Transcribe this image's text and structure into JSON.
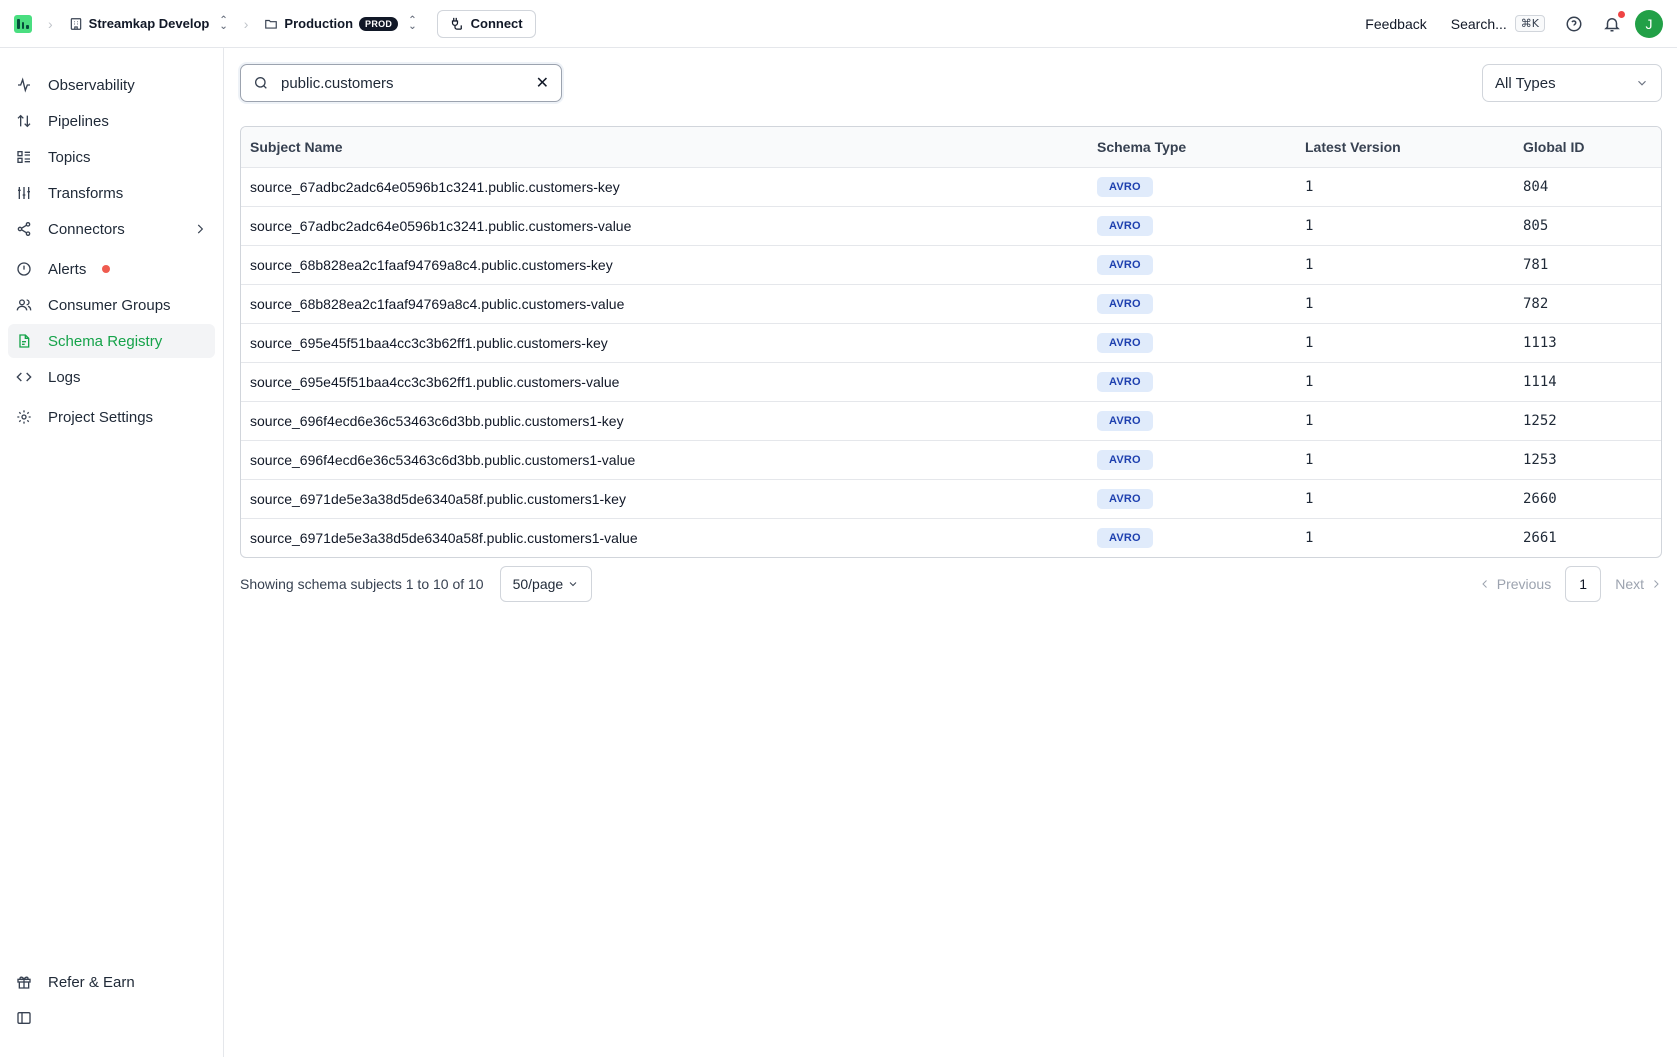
{
  "topbar": {
    "org": "Streamkap Develop",
    "project": "Production",
    "project_badge": "PROD",
    "connect_label": "Connect",
    "feedback_label": "Feedback",
    "search_label": "Search...",
    "search_shortcut": "⌘K",
    "avatar_initial": "J",
    "accent_color": "#22a047"
  },
  "sidebar": {
    "items": [
      {
        "label": "Observability",
        "icon": "activity-icon"
      },
      {
        "label": "Pipelines",
        "icon": "arrows-up-down-icon"
      },
      {
        "label": "Topics",
        "icon": "list-icon"
      },
      {
        "label": "Transforms",
        "icon": "sliders-icon"
      },
      {
        "label": "Connectors",
        "icon": "share-icon"
      },
      {
        "label": "Alerts",
        "icon": "alert-circle-icon"
      },
      {
        "label": "Consumer Groups",
        "icon": "users-icon"
      },
      {
        "label": "Schema Registry",
        "icon": "file-icon",
        "active": true
      },
      {
        "label": "Logs",
        "icon": "code-icon"
      },
      {
        "label": "Project Settings",
        "icon": "gear-icon"
      }
    ],
    "bottom": {
      "refer_label": "Refer & Earn"
    }
  },
  "filters": {
    "search_value": "public.customers",
    "type_select": "All Types"
  },
  "table": {
    "headers": [
      "Subject Name",
      "Schema Type",
      "Latest Version",
      "Global ID"
    ],
    "rows": [
      {
        "subject": "source_67adbc2adc64e0596b1c3241.public.customers-key",
        "type": "AVRO",
        "version": "1",
        "id": "804"
      },
      {
        "subject": "source_67adbc2adc64e0596b1c3241.public.customers-value",
        "type": "AVRO",
        "version": "1",
        "id": "805"
      },
      {
        "subject": "source_68b828ea2c1faaf94769a8c4.public.customers-key",
        "type": "AVRO",
        "version": "1",
        "id": "781"
      },
      {
        "subject": "source_68b828ea2c1faaf94769a8c4.public.customers-value",
        "type": "AVRO",
        "version": "1",
        "id": "782"
      },
      {
        "subject": "source_695e45f51baa4cc3c3b62ff1.public.customers-key",
        "type": "AVRO",
        "version": "1",
        "id": "1113"
      },
      {
        "subject": "source_695e45f51baa4cc3c3b62ff1.public.customers-value",
        "type": "AVRO",
        "version": "1",
        "id": "1114"
      },
      {
        "subject": "source_696f4ecd6e36c53463c6d3bb.public.customers1-key",
        "type": "AVRO",
        "version": "1",
        "id": "1252"
      },
      {
        "subject": "source_696f4ecd6e36c53463c6d3bb.public.customers1-value",
        "type": "AVRO",
        "version": "1",
        "id": "1253"
      },
      {
        "subject": "source_6971de5e3a38d5de6340a58f.public.customers1-key",
        "type": "AVRO",
        "version": "1",
        "id": "2660"
      },
      {
        "subject": "source_6971de5e3a38d5de6340a58f.public.customers1-value",
        "type": "AVRO",
        "version": "1",
        "id": "2661"
      }
    ]
  },
  "pagination": {
    "showing_text": "Showing schema subjects 1 to 10 of 10",
    "per_page": "50/page",
    "previous_label": "Previous",
    "current_page": "1",
    "next_label": "Next"
  }
}
